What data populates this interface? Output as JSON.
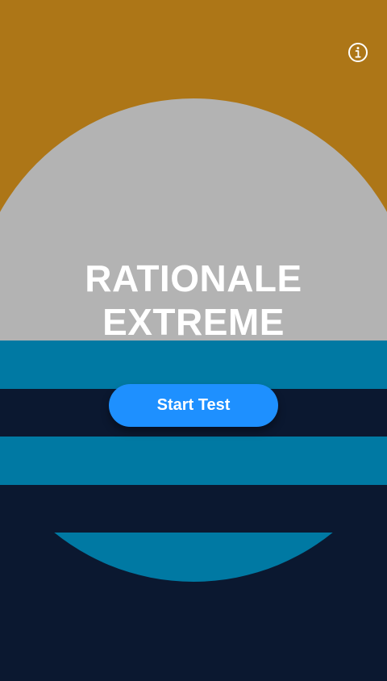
{
  "title": {
    "line1": "RATIONALE",
    "line2": "EXTREME"
  },
  "start_button_label": "Start Test",
  "info_icon": "info-circle-icon",
  "colors": {
    "sky": "#ad7617",
    "sun": "#b3b3b3",
    "water_band": "#0079a3",
    "deep": "#0b1830",
    "button": "#1e90ff",
    "text": "#ffffff"
  }
}
